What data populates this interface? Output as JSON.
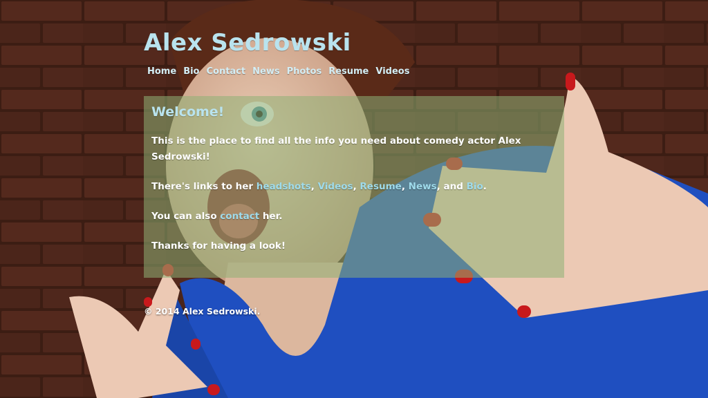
{
  "site": {
    "title": "Alex Sedrowski"
  },
  "nav": {
    "items": [
      "Home",
      "Bio",
      "Contact",
      "News",
      "Photos",
      "Resume",
      "Videos"
    ]
  },
  "welcome": {
    "heading": "Welcome!",
    "p1": "This is the place to find all the info you need about comedy actor Alex Sedrowski!",
    "p2_prefix": "There's links to her ",
    "p2_links": [
      "headshots",
      "Videos",
      "Resume",
      "News",
      "Bio"
    ],
    "p2_sep": ", ",
    "p2_and": ", and ",
    "p2_suffix": ".",
    "p3_prefix": "You can also ",
    "p3_link": "contact",
    "p3_suffix": " her.",
    "p4": "Thanks for having a look!"
  },
  "footer": {
    "copyright": "© 2014 Alex Sedrowski."
  },
  "colors": {
    "title": "#b9e3ee",
    "link": "#9fdbeb",
    "panel": "rgba(142,176,116,0.55)",
    "brick": "#5a2e22",
    "shirt": "#1f4fc0",
    "nail": "#c8191c"
  }
}
